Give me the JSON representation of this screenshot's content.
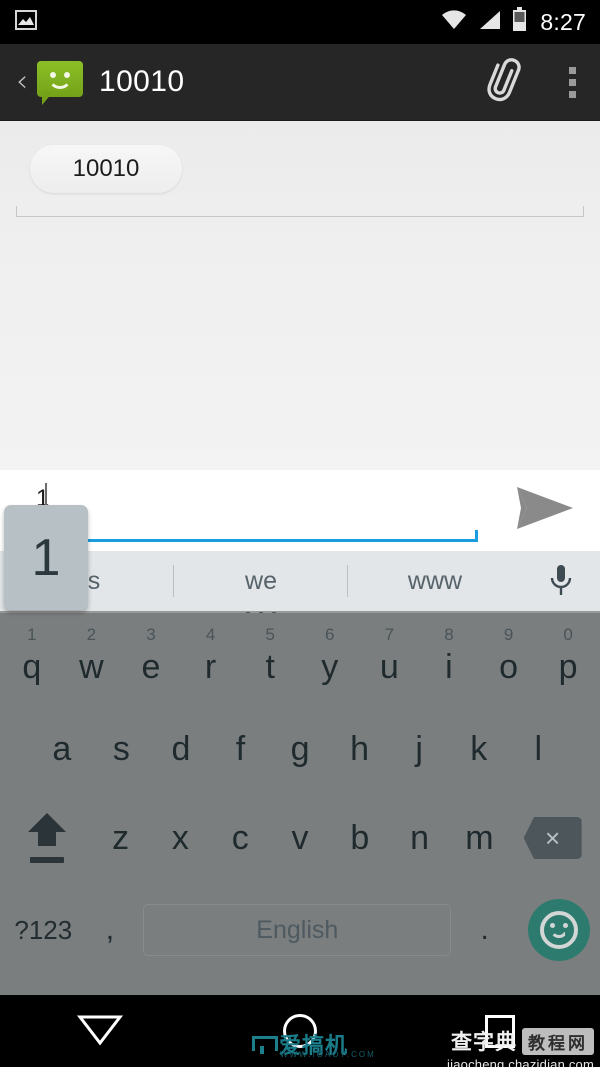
{
  "status_bar": {
    "notification_icon": "image-icon",
    "wifi_icon": "wifi-icon",
    "signal_icon": "cell-signal-icon",
    "battery_icon": "battery-icon",
    "clock": "8:27"
  },
  "app_bar": {
    "back_label": "‹",
    "app_icon": "sms-bubble-icon",
    "title": "10010",
    "attach_icon": "paperclip-icon",
    "overflow_icon": "overflow-menu-icon"
  },
  "conversation": {
    "recipient_chip": "10010"
  },
  "compose": {
    "text_value": "1",
    "send_icon": "send-arrow-icon",
    "accent_color": "#1a9de0"
  },
  "keyboard": {
    "key_popup": "1",
    "suggestions": [
      {
        "label": "as",
        "has_more_dots": false
      },
      {
        "label": "we",
        "has_more_dots": true
      },
      {
        "label": "www",
        "has_more_dots": false
      }
    ],
    "mic_icon": "microphone-icon",
    "row1": [
      {
        "key": "q",
        "num": "1"
      },
      {
        "key": "w",
        "num": "2"
      },
      {
        "key": "e",
        "num": "3"
      },
      {
        "key": "r",
        "num": "4"
      },
      {
        "key": "t",
        "num": "5"
      },
      {
        "key": "y",
        "num": "6"
      },
      {
        "key": "u",
        "num": "7"
      },
      {
        "key": "i",
        "num": "8"
      },
      {
        "key": "o",
        "num": "9"
      },
      {
        "key": "p",
        "num": "0"
      }
    ],
    "row2": [
      "a",
      "s",
      "d",
      "f",
      "g",
      "h",
      "j",
      "k",
      "l"
    ],
    "row3": {
      "shift_icon": "shift-key-icon",
      "letters": [
        "z",
        "x",
        "c",
        "v",
        "b",
        "n",
        "m"
      ],
      "backspace_icon": "backspace-key-icon",
      "backspace_glyph": "×"
    },
    "row4": {
      "symbols_label": "?123",
      "comma": ",",
      "space_label": "English",
      "period": ".",
      "emoji_icon": "emoji-key-icon"
    },
    "key_color": "#7b7e7f",
    "suggestion_bar_color": "#e2e6e8",
    "emoji_color": "#2d7b6e"
  },
  "nav_bar": {
    "back_icon": "nav-back-triangle-icon",
    "home_icon": "nav-home-circle-icon",
    "recents_icon": "nav-recents-square-icon"
  },
  "watermarks": {
    "left": {
      "text": "爱搞机",
      "url": "WWW.IGAO7.COM"
    },
    "right": {
      "text1": "查字典",
      "text2": "教程网",
      "url": "jiaocheng.chazidian.com"
    }
  }
}
